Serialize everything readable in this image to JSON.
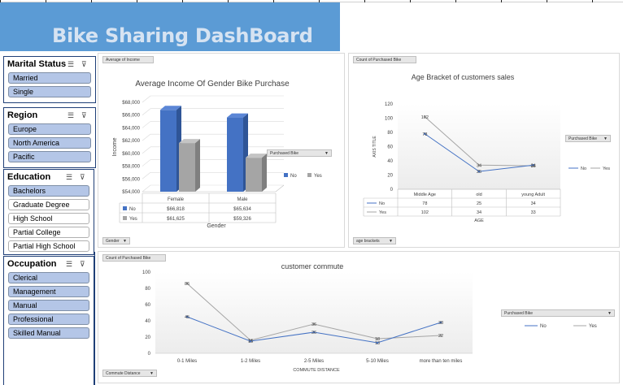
{
  "title": "Bike Sharing DashBoard",
  "colors": {
    "banner": "#5b9bd5",
    "no": "#4472c4",
    "yes": "#a5a5a5",
    "slicer_selected": "#b4c6e7"
  },
  "slicers": [
    {
      "key": "marital",
      "header": "Marital Status",
      "items": [
        {
          "label": "Married",
          "selected": true
        },
        {
          "label": "Single",
          "selected": true
        }
      ]
    },
    {
      "key": "region",
      "header": "Region",
      "items": [
        {
          "label": "Europe",
          "selected": true
        },
        {
          "label": "North America",
          "selected": true
        },
        {
          "label": "Pacific",
          "selected": true
        }
      ]
    },
    {
      "key": "education",
      "header": "Education",
      "items": [
        {
          "label": "Bachelors",
          "selected": true
        },
        {
          "label": "Graduate Degree",
          "selected": false
        },
        {
          "label": "High School",
          "selected": false
        },
        {
          "label": "Partial College",
          "selected": false
        },
        {
          "label": "Partial High School",
          "selected": false
        }
      ]
    },
    {
      "key": "occupation",
      "header": "Occupation",
      "items": [
        {
          "label": "Clerical",
          "selected": true
        },
        {
          "label": "Management",
          "selected": true
        },
        {
          "label": "Manual",
          "selected": true
        },
        {
          "label": "Professional",
          "selected": true
        },
        {
          "label": "Skilled Manual",
          "selected": true
        }
      ]
    }
  ],
  "income_chart": {
    "tag": "Average of Income",
    "filter_button": "Purchased Bike",
    "axis_button": "Gender",
    "chart_data": {
      "type": "bar",
      "title": "Average Income Of  Gender  Bike Purchase",
      "xlabel": "Gender",
      "ylabel": "Income",
      "categories": [
        "Female",
        "Male"
      ],
      "ylim": [
        54000,
        68000
      ],
      "yticks": [
        "$54,000",
        "$56,000",
        "$58,000",
        "$60,000",
        "$62,000",
        "$64,000",
        "$66,000",
        "$68,000"
      ],
      "series": [
        {
          "name": "No",
          "values": [
            66818,
            65634
          ],
          "labels": [
            "$66,818",
            "$65,634"
          ]
        },
        {
          "name": "Yes",
          "values": [
            61625,
            59326
          ],
          "labels": [
            "$61,625",
            "$59,326"
          ]
        }
      ]
    }
  },
  "age_chart": {
    "tag": "Count of Purchased Bike",
    "filter_button": "Purchased Bike",
    "axis_button": "age brackets",
    "chart_data": {
      "type": "line",
      "title": "Age Bracket of customers sales",
      "xlabel": "AGE",
      "ylabel": "AXIS TITLE",
      "categories": [
        "Middle Age",
        "old",
        "young Adult"
      ],
      "ylim": [
        0,
        120
      ],
      "yticks": [
        "0",
        "20",
        "40",
        "60",
        "80",
        "100",
        "120"
      ],
      "series": [
        {
          "name": "No",
          "values": [
            78,
            25,
            34
          ]
        },
        {
          "name": "Yes",
          "values": [
            102,
            34,
            33
          ]
        }
      ]
    }
  },
  "commute_chart": {
    "tag": "Count of Purchased Bike",
    "filter_button": "Purchased Bike",
    "axis_button": "Commute Distance",
    "chart_data": {
      "type": "line",
      "title": "customer commute",
      "xlabel": "COMMUTE DISTANCE",
      "categories": [
        "0-1 Miles",
        "1-2 Miles",
        "2-5 Miles",
        "5-10 Miles",
        "more than ten miles"
      ],
      "ylim": [
        0,
        100
      ],
      "yticks": [
        "0",
        "20",
        "40",
        "60",
        "80",
        "100"
      ],
      "series": [
        {
          "name": "No",
          "values": [
            45,
            15,
            26,
            13,
            38
          ]
        },
        {
          "name": "Yes",
          "values": [
            86,
            16,
            36,
            18,
            22
          ]
        }
      ]
    }
  }
}
